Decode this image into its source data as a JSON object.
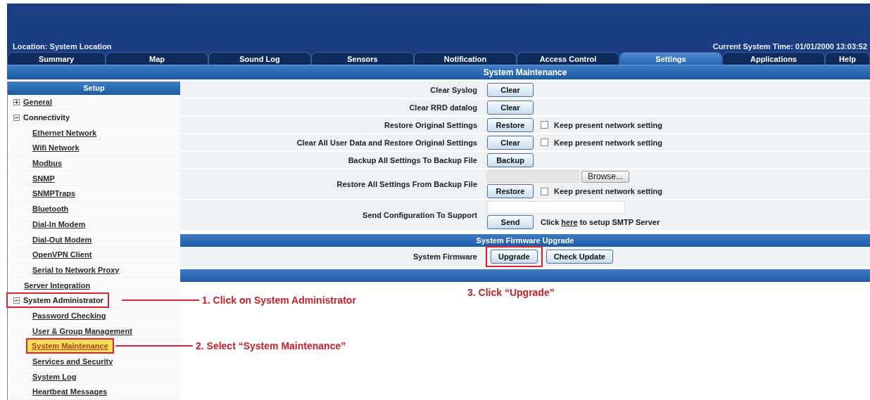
{
  "header": {
    "location": "Location: System Location",
    "system_time": "Current System Time: 01/01/2000 13:03:52"
  },
  "tabs": [
    {
      "label": "Summary",
      "selected": false
    },
    {
      "label": "Map",
      "selected": false
    },
    {
      "label": "Sound Log",
      "selected": false
    },
    {
      "label": "Sensors",
      "selected": false
    },
    {
      "label": "Notification",
      "selected": false
    },
    {
      "label": "Access Control",
      "selected": false
    },
    {
      "label": "Settings",
      "selected": true
    },
    {
      "label": "Applications",
      "selected": false
    },
    {
      "label": "Help",
      "selected": false
    }
  ],
  "page_title": "System Maintenance",
  "sidebar": {
    "title": "Setup",
    "items": [
      {
        "label": "General",
        "kind": "group",
        "expanded": false,
        "selected": false
      },
      {
        "label": "Connectivity",
        "kind": "group",
        "expanded": true,
        "selected": false,
        "children": [
          {
            "label": "Ethernet Network",
            "selected": false
          },
          {
            "label": "Wifi Network",
            "selected": false
          },
          {
            "label": "Modbus",
            "selected": false
          },
          {
            "label": "SNMP",
            "selected": false
          },
          {
            "label": "SNMPTraps",
            "selected": false
          },
          {
            "label": "Bluetooth",
            "selected": false
          },
          {
            "label": "Dial-In Modem",
            "selected": false
          },
          {
            "label": "Dial-Out Modem",
            "selected": false
          },
          {
            "label": "OpenVPN Client",
            "selected": false
          },
          {
            "label": "Serial to Network Proxy",
            "selected": false
          }
        ]
      },
      {
        "label": "Server Integration",
        "kind": "link",
        "selected": false
      },
      {
        "label": "System Administrator",
        "kind": "group",
        "expanded": true,
        "selected": false,
        "callout": "1. Click on System Administrator",
        "children": [
          {
            "label": "Password Checking",
            "selected": false
          },
          {
            "label": "User & Group Management",
            "selected": false
          },
          {
            "label": "System Maintenance",
            "selected": true,
            "callout": "2. Select “System Maintenance”"
          },
          {
            "label": "Services and Security",
            "selected": false
          },
          {
            "label": "System Log",
            "selected": false
          },
          {
            "label": "Heartbeat Messages",
            "selected": false
          }
        ]
      }
    ]
  },
  "maintenance_rows": [
    {
      "label": "Clear Syslog",
      "lines": [
        [
          {
            "kind": "button",
            "label": "Clear"
          }
        ]
      ]
    },
    {
      "label": "Clear RRD datalog",
      "lines": [
        [
          {
            "kind": "button",
            "label": "Clear"
          }
        ]
      ]
    },
    {
      "label": "Restore Original Settings",
      "lines": [
        [
          {
            "kind": "button",
            "label": "Restore"
          },
          {
            "kind": "checkbox",
            "label": "Keep present network setting",
            "checked": false
          }
        ]
      ]
    },
    {
      "label": "Clear All User Data and Restore Original Settings",
      "lines": [
        [
          {
            "kind": "button",
            "label": "Clear"
          },
          {
            "kind": "checkbox",
            "label": "Keep present network setting",
            "checked": false
          }
        ]
      ]
    },
    {
      "label": "Backup All Settings To Backup File",
      "lines": [
        [
          {
            "kind": "button",
            "label": "Backup"
          }
        ]
      ]
    },
    {
      "label": "Restore All Settings From Backup File",
      "lines": [
        [
          {
            "kind": "file",
            "button": "Browse..."
          }
        ],
        [
          {
            "kind": "button",
            "label": "Restore"
          },
          {
            "kind": "checkbox",
            "label": "Keep present network setting",
            "checked": false
          }
        ]
      ]
    },
    {
      "label": "Send Configuration To Support",
      "lines": [
        [
          {
            "kind": "input"
          }
        ],
        [
          {
            "kind": "button",
            "label": "Send"
          },
          {
            "kind": "note",
            "before": "Click",
            "link": "here",
            "after": "to setup SMTP Server"
          }
        ]
      ]
    }
  ],
  "firmware": {
    "title": "System Firmware Upgrade",
    "label": "System Firmware",
    "buttons": [
      {
        "label": "Upgrade",
        "callout": "3. Click “Upgrade”"
      },
      {
        "label": "Check Update"
      }
    ]
  }
}
